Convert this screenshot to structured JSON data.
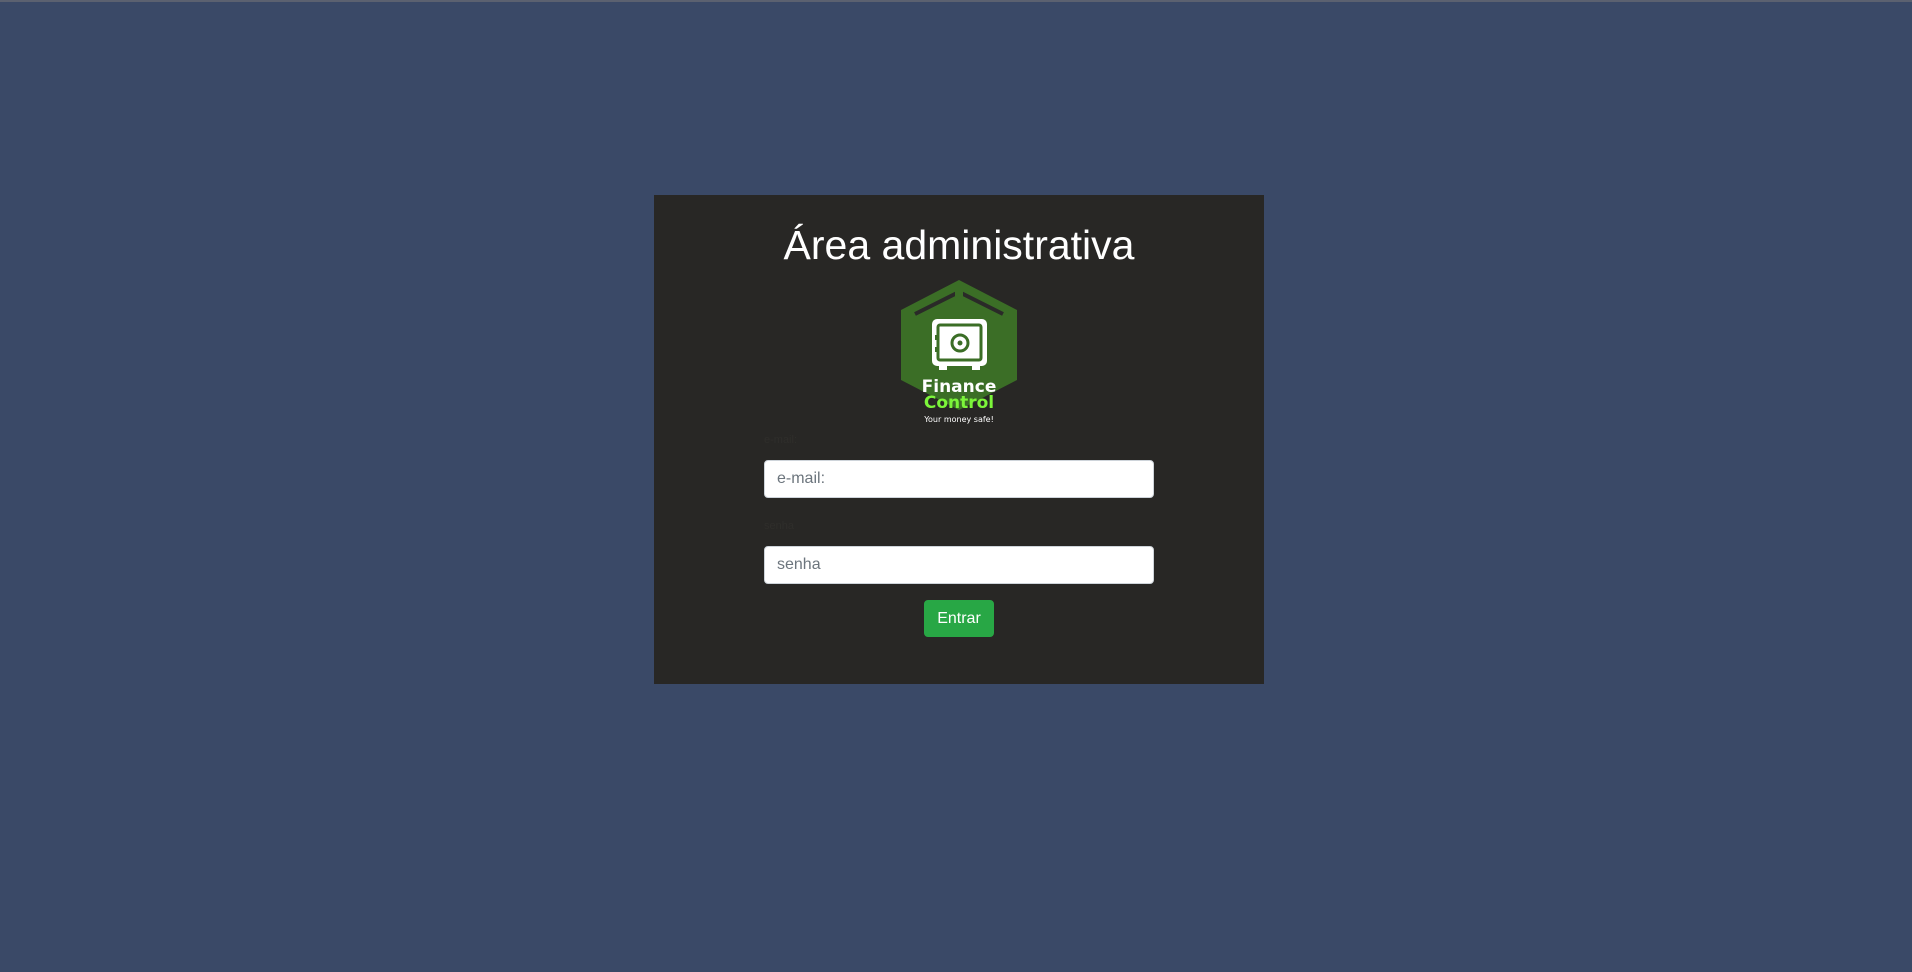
{
  "page": {
    "title": "Área administrativa"
  },
  "logo": {
    "brand_line1": "Finance",
    "brand_line2": "Control",
    "tagline": "Your money safe!",
    "colors": {
      "hexagon": "#3b6e26",
      "accent": "#7cf53a",
      "white": "#ffffff"
    }
  },
  "form": {
    "email_label": "e-mail:",
    "email_placeholder": "e-mail:",
    "password_label": "senha",
    "password_placeholder": "senha",
    "submit_label": "Entrar"
  },
  "colors": {
    "background": "#3a4967",
    "card": "#282725",
    "button": "#28a745"
  }
}
